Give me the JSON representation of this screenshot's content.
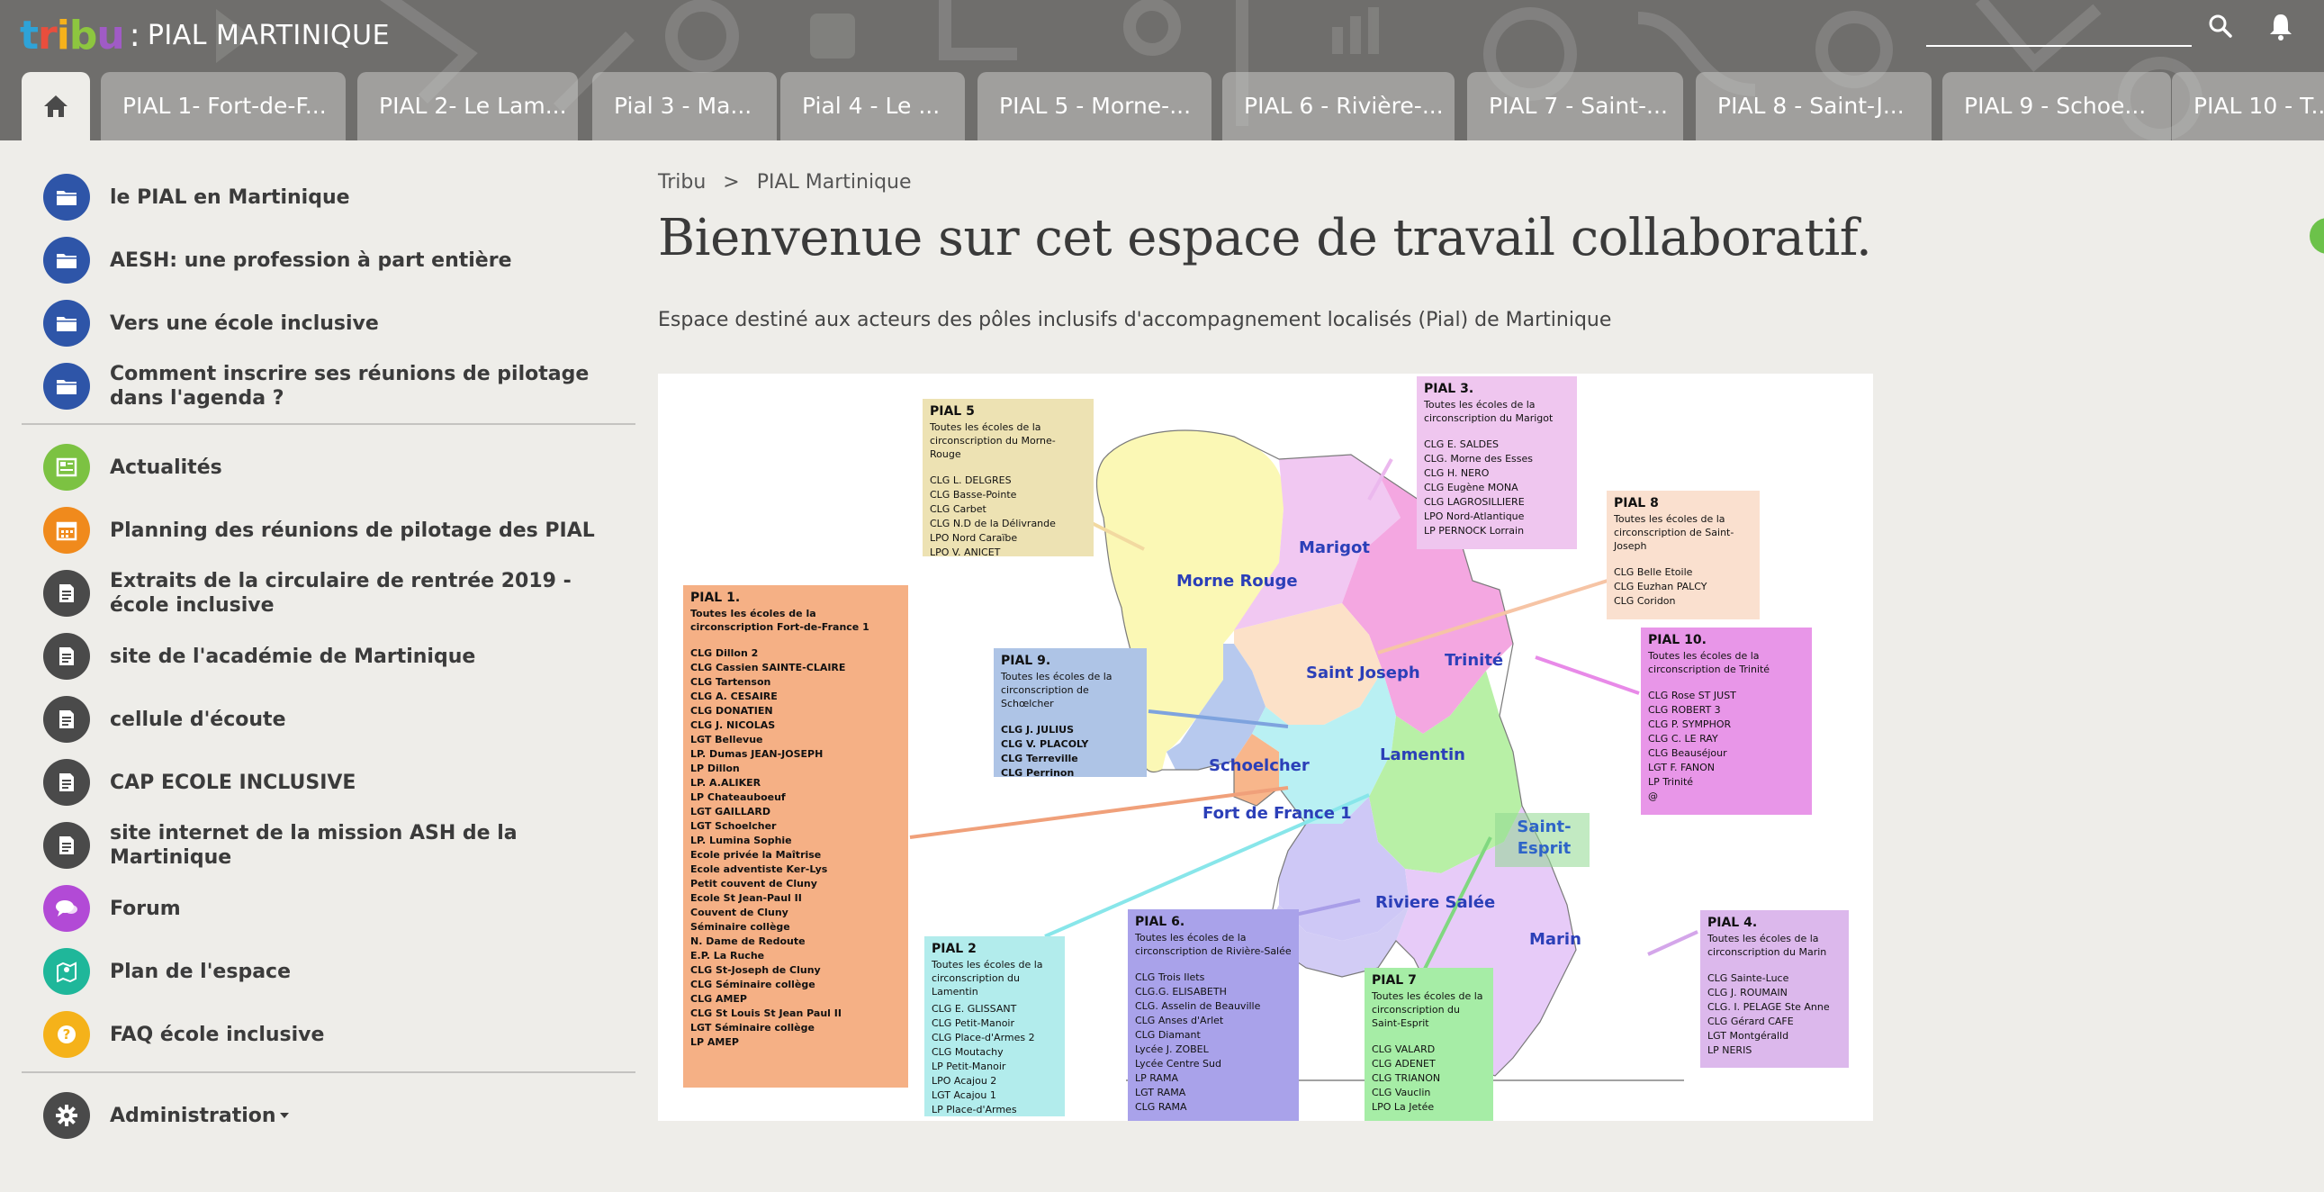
{
  "header": {
    "logo_text": "tribu",
    "separator": ":",
    "site_title": "PIAL MARTINIQUE",
    "tabs": [
      {
        "label": "PIAL 1- Fort-de-F..."
      },
      {
        "label": "PIAL 2- Le Lam..."
      },
      {
        "label": "Pial 3 - Ma..."
      },
      {
        "label": "Pial 4 - Le ..."
      },
      {
        "label": "PIAL 5 - Morne-..."
      },
      {
        "label": "PIAL 6 - Rivière-..."
      },
      {
        "label": "PIAL 7 - Saint-..."
      },
      {
        "label": "PIAL 8 - Saint-J..."
      },
      {
        "label": "PIAL 9 - Schoe..."
      },
      {
        "label": "PIAL 10 - T..."
      }
    ]
  },
  "sidebar": {
    "group1": [
      {
        "label": "le PIAL en Martinique",
        "icon": "folder-icon",
        "color": "#2e55a8"
      },
      {
        "label": "AESH: une profession à part entière",
        "icon": "folder-icon",
        "color": "#2e55a8"
      },
      {
        "label": "Vers une école inclusive",
        "icon": "folder-icon",
        "color": "#2e55a8"
      },
      {
        "label": "Comment inscrire ses réunions de pilotage dans l'agenda ?",
        "icon": "folder-icon",
        "color": "#2e55a8"
      }
    ],
    "group2": [
      {
        "label": "Actualités",
        "icon": "news-icon",
        "color": "#7cc242"
      },
      {
        "label": "Planning des réunions de pilotage des PIAL",
        "icon": "calendar-icon",
        "color": "#f08a1c"
      },
      {
        "label": "Extraits de la circulaire de rentrée 2019 - école inclusive",
        "icon": "document-icon",
        "color": "#4a4a4a"
      },
      {
        "label": "site de l'académie de Martinique",
        "icon": "document-icon",
        "color": "#4a4a4a"
      },
      {
        "label": "cellule d'écoute",
        "icon": "document-icon",
        "color": "#4a4a4a"
      },
      {
        "label": "CAP ECOLE INCLUSIVE",
        "icon": "document-icon",
        "color": "#4a4a4a"
      },
      {
        "label": "site internet de la mission ASH de la Martinique",
        "icon": "document-icon",
        "color": "#4a4a4a"
      },
      {
        "label": "Forum",
        "icon": "chat-icon",
        "color": "#b24ad6"
      },
      {
        "label": "Plan de l'espace",
        "icon": "map-icon",
        "color": "#1fb79a"
      },
      {
        "label": "FAQ école inclusive",
        "icon": "question-icon",
        "color": "#f5b21a"
      }
    ],
    "admin": {
      "label": "Administration",
      "icon": "gear-icon",
      "color": "#4a4a4a"
    }
  },
  "main": {
    "breadcrumb": [
      "Tribu",
      ">",
      "PIAL Martinique"
    ],
    "title": "Bienvenue sur cet espace de travail collaboratif.",
    "description": "Espace destiné aux acteurs des pôles inclusifs d'accompagnement localisés (Pial) de Martinique"
  },
  "map": {
    "regions": [
      "Morne Rouge",
      "Marigot",
      "Saint Joseph",
      "Trinité",
      "Schoelcher",
      "Lamentin",
      "Fort de France 1",
      "Saint-Esprit",
      "Riviere Salée",
      "Marin"
    ],
    "pials": [
      {
        "title": "PIAL 5",
        "desc": "Toutes les écoles de la circonscription du Morne-Rouge",
        "lines": [
          "CLG L. DELGRES",
          "CLG Basse-Pointe",
          "CLG Carbet",
          "CLG N.D de la Délivrande",
          "LPO Nord Caraïbe",
          "LPO V. ANICET"
        ],
        "color": "#ede2b3"
      },
      {
        "title": "PIAL 3.",
        "desc": "Toutes les écoles de la circonscription du Marigot",
        "lines": [
          "CLG E. SALDES",
          "CLG. Morne des Esses",
          "CLG H. NERO",
          "CLG Eugène MONA",
          "CLG LAGROSILLIERE",
          "LPO Nord-Atlantique",
          "LP PERNOCK Lorrain"
        ],
        "color": "#efc6ef"
      },
      {
        "title": "PIAL 8",
        "desc": "Toutes les écoles de la circonscription de Saint-Joseph",
        "lines": [
          "CLG Belle Etoile",
          "CLG Euzhan PALCY",
          "CLG Coridon"
        ],
        "color": "#fae0cf"
      },
      {
        "title": "PIAL 1.",
        "desc": "Toutes les écoles de la circonscription Fort-de-France 1",
        "lines": [
          "CLG Dillon 2",
          "CLG Cassien SAINTE-CLAIRE",
          "CLG Tartenson",
          "CLG A. CESAIRE",
          "CLG DONATIEN",
          "CLG J. NICOLAS",
          "LGT Bellevue",
          "LP. Dumas JEAN-JOSEPH",
          "LP Dillon",
          "LP. A.ALIKER",
          "LP Chateauboeuf",
          "LGT GAILLARD",
          "LGT Schoelcher",
          "LP. Lumina Sophie",
          "Ecole privée la Maîtrise",
          "Ecole adventiste Ker-Lys",
          "Petit couvent de Cluny",
          "Ecole St Jean-Paul II",
          "Couvent de Cluny",
          "Séminaire collège",
          "N. Dame de Redoute",
          "E.P. La Ruche",
          "CLG St-Joseph de Cluny",
          "CLG Séminaire collège",
          "CLG AMEP",
          "CLG St Louis St Jean Paul II",
          "LGT Séminaire collège",
          "LP AMEP"
        ],
        "color": "#f5b085"
      },
      {
        "title": "PIAL 9.",
        "desc": "Toutes les écoles de la circonscription de Schœlcher",
        "lines": [
          "CLG J. JULIUS",
          "CLG V. PLACOLY",
          "CLG Terreville",
          "CLG Perrinon"
        ],
        "color": "#aec4e6"
      },
      {
        "title": "PIAL 10.",
        "desc": "Toutes les écoles de la circonscription de Trinité",
        "lines": [
          "CLG Rose ST JUST",
          "CLG ROBERT 3",
          "CLG P. SYMPHOR",
          "CLG C. LE RAY",
          "CLG Beauséjour",
          "LGT F. FANON",
          "LP Trinité",
          "@"
        ],
        "color": "#e896e8"
      },
      {
        "title": "PIAL 2",
        "desc": "Toutes les écoles de la circonscription du Lamentin",
        "lines": [
          "CLG E. GLISSANT",
          "CLG Petit-Manoir",
          "CLG Place-d'Armes 2",
          "CLG Moutachy",
          "LP Petit-Manoir",
          "LPO Acajou 2",
          "LGT Acajou 1",
          "LP Place-d'Armes"
        ],
        "color": "#b2ecec"
      },
      {
        "title": "PIAL 6.",
        "desc": "Toutes les écoles de la circonscription de Rivière-Salée",
        "lines": [
          "CLG Trois Ilets",
          "CLG.G. ELISABETH",
          "CLG. Asselin de Beauville",
          "CLG Anses d'Arlet",
          "CLG Diamant",
          "Lycée J. ZOBEL",
          "Lycée Centre Sud",
          "LP RAMA",
          "LGT RAMA",
          "CLG RAMA"
        ],
        "color": "#a9a2ea"
      },
      {
        "title": "PIAL 7",
        "desc": "Toutes les écoles de la circonscription du Saint-Esprit",
        "lines": [
          "CLG VALARD",
          "CLG ADENET",
          "CLG TRIANON",
          "CLG Vauclin",
          "LPO La Jetée"
        ],
        "color": "#a6eda6"
      },
      {
        "title": "PIAL 4.",
        "desc": "Toutes les écoles de la circonscription du Marin",
        "lines": [
          "CLG Sainte-Luce",
          "CLG J. ROUMAIN",
          "CLG. I. PELAGE Ste Anne",
          "CLG Gérard CAFE",
          "LGT Montgéralld",
          "LP NERIS"
        ],
        "color": "#dcb8ec"
      }
    ]
  }
}
